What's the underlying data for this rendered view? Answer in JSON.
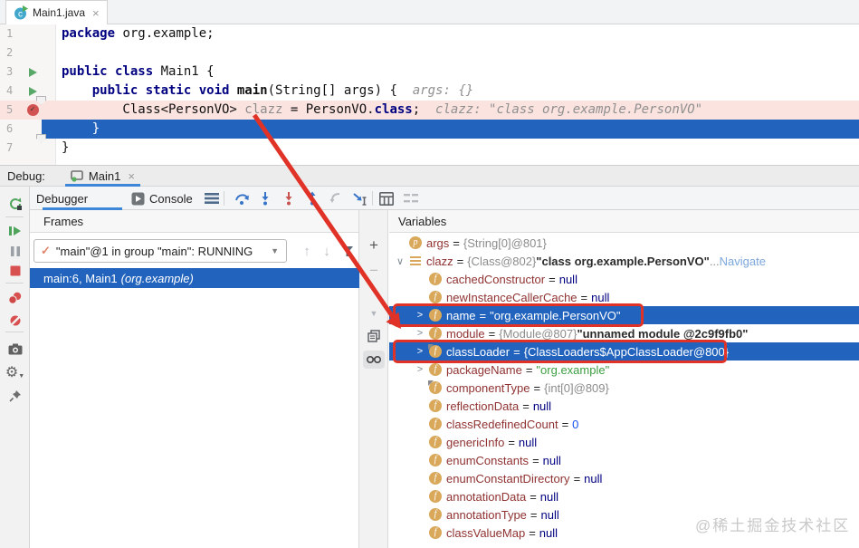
{
  "window": {
    "watermark": "@稀土掘金技术社区"
  },
  "colors": {
    "accent_blue": "#3e86d8",
    "selection_blue": "#2263bd",
    "breakpoint_pink": "#fbe3df",
    "annotation_red": "#e03226",
    "icon_amber": "#d9a85a",
    "name_maroon": "#8f3231",
    "string_green": "#3d9e41"
  },
  "icons": {
    "close": "×",
    "caret_down": "▼",
    "up_arrow": "↑",
    "down_arrow": "↓",
    "check": "✓",
    "plus": "+",
    "minus": "−",
    "scroll_caret": "▼",
    "expander_closed": ">",
    "expander_open": "∨",
    "gear": "⚙"
  },
  "editor": {
    "tab_title": "Main1.java",
    "lines": [
      {
        "num": "1",
        "icon": null,
        "fold": null,
        "bg": null,
        "tokens": [
          {
            "t": "package ",
            "c": "kw"
          },
          {
            "t": "org.example;",
            "c": "pl"
          }
        ]
      },
      {
        "num": "2",
        "icon": null,
        "fold": null,
        "bg": null,
        "tokens": []
      },
      {
        "num": "3",
        "icon": "run",
        "fold": null,
        "bg": null,
        "tokens": [
          {
            "t": "public class ",
            "c": "kw"
          },
          {
            "t": "Main1 {",
            "c": "pl"
          }
        ]
      },
      {
        "num": "4",
        "icon": "run",
        "fold": "mid",
        "bg": null,
        "tokens": [
          {
            "t": "    ",
            "c": "pl"
          },
          {
            "t": "public static void ",
            "c": "kw"
          },
          {
            "t": "main",
            "c": "plb"
          },
          {
            "t": "(String[] args) {",
            "c": "pl"
          },
          {
            "t": "  args: {}",
            "c": "hint"
          }
        ]
      },
      {
        "num": "5",
        "icon": "breakpoint",
        "fold": null,
        "bg": "bp",
        "tokens": [
          {
            "t": "        Class<PersonVO> ",
            "c": "pl"
          },
          {
            "t": "clazz ",
            "c": "gray"
          },
          {
            "t": "= PersonVO.",
            "c": "pl"
          },
          {
            "t": "class",
            "c": "kw"
          },
          {
            "t": ";",
            "c": "pl"
          },
          {
            "t": "  clazz: \"class org.example.PersonVO\"",
            "c": "hint"
          }
        ]
      },
      {
        "num": "6",
        "icon": null,
        "fold": "end",
        "bg": "exec",
        "tokens": [
          {
            "t": "    }",
            "c": "pl"
          }
        ]
      },
      {
        "num": "7",
        "icon": null,
        "fold": null,
        "bg": null,
        "tokens": [
          {
            "t": "}",
            "c": "pl"
          }
        ]
      }
    ]
  },
  "debug": {
    "label": "Debug:",
    "session_tab": "Main1",
    "tabs": {
      "debugger": "Debugger",
      "console": "Console"
    },
    "frames": {
      "header": "Frames",
      "thread_dropdown": "\"main\"@1 in group \"main\": RUNNING",
      "frame_text": "main:6, Main1",
      "frame_location": "(org.example)"
    },
    "variables": {
      "header": "Variables",
      "rows": [
        {
          "level": 0,
          "expander": null,
          "icon": "p",
          "name": "args",
          "selected": false,
          "values": [
            {
              "t": "{String[0]@801}",
              "c": "ref"
            }
          ]
        },
        {
          "level": 0,
          "expander": "open",
          "icon": "bars",
          "name": "clazz",
          "selected": false,
          "values": [
            {
              "t": "{Class@802} ",
              "c": "ref"
            },
            {
              "t": "\"class org.example.PersonVO\"",
              "c": "bold"
            },
            {
              "t": " ... ",
              "c": "ref"
            },
            {
              "t": "Navigate",
              "c": "link"
            }
          ]
        },
        {
          "level": 1,
          "expander": null,
          "icon": "f",
          "name": "cachedConstructor",
          "selected": false,
          "values": [
            {
              "t": "null",
              "c": "kw"
            }
          ]
        },
        {
          "level": 1,
          "expander": null,
          "icon": "f",
          "name": "newInstanceCallerCache",
          "selected": false,
          "values": [
            {
              "t": "null",
              "c": "kw"
            }
          ]
        },
        {
          "level": 1,
          "expander": "closed",
          "icon": "f",
          "name": "name",
          "selected": true,
          "values": [
            {
              "t": "\"org.example.PersonVO\"",
              "c": "white"
            }
          ]
        },
        {
          "level": 1,
          "expander": "closed",
          "icon": "f",
          "name": "module",
          "selected": false,
          "values": [
            {
              "t": "{Module@807} ",
              "c": "ref"
            },
            {
              "t": "\"unnamed module @2c9f9fb0\"",
              "c": "bold"
            }
          ]
        },
        {
          "level": 1,
          "expander": "closed",
          "icon": "f-overlay",
          "name": "classLoader",
          "selected": true,
          "values": [
            {
              "t": "{ClassLoaders$AppClassLoader@800}",
              "c": "white"
            }
          ]
        },
        {
          "level": 1,
          "expander": "closed",
          "icon": "f",
          "name": "packageName",
          "selected": false,
          "values": [
            {
              "t": "\"org.example\"",
              "c": "str"
            }
          ]
        },
        {
          "level": 1,
          "expander": null,
          "icon": "f-overlay",
          "name": "componentType",
          "selected": false,
          "values": [
            {
              "t": "{int[0]@809}",
              "c": "ref"
            }
          ]
        },
        {
          "level": 1,
          "expander": null,
          "icon": "f",
          "name": "reflectionData",
          "selected": false,
          "values": [
            {
              "t": "null",
              "c": "kw"
            }
          ]
        },
        {
          "level": 1,
          "expander": null,
          "icon": "f",
          "name": "classRedefinedCount",
          "selected": false,
          "values": [
            {
              "t": "0",
              "c": "num"
            }
          ]
        },
        {
          "level": 1,
          "expander": null,
          "icon": "f",
          "name": "genericInfo",
          "selected": false,
          "values": [
            {
              "t": "null",
              "c": "kw"
            }
          ]
        },
        {
          "level": 1,
          "expander": null,
          "icon": "f",
          "name": "enumConstants",
          "selected": false,
          "values": [
            {
              "t": "null",
              "c": "kw"
            }
          ]
        },
        {
          "level": 1,
          "expander": null,
          "icon": "f",
          "name": "enumConstantDirectory",
          "selected": false,
          "values": [
            {
              "t": "null",
              "c": "kw"
            }
          ]
        },
        {
          "level": 1,
          "expander": null,
          "icon": "f",
          "name": "annotationData",
          "selected": false,
          "values": [
            {
              "t": "null",
              "c": "kw"
            }
          ]
        },
        {
          "level": 1,
          "expander": null,
          "icon": "f",
          "name": "annotationType",
          "selected": false,
          "values": [
            {
              "t": "null",
              "c": "kw"
            }
          ]
        },
        {
          "level": 1,
          "expander": null,
          "icon": "f",
          "name": "classValueMap",
          "selected": false,
          "values": [
            {
              "t": "null",
              "c": "kw"
            }
          ]
        }
      ]
    }
  }
}
